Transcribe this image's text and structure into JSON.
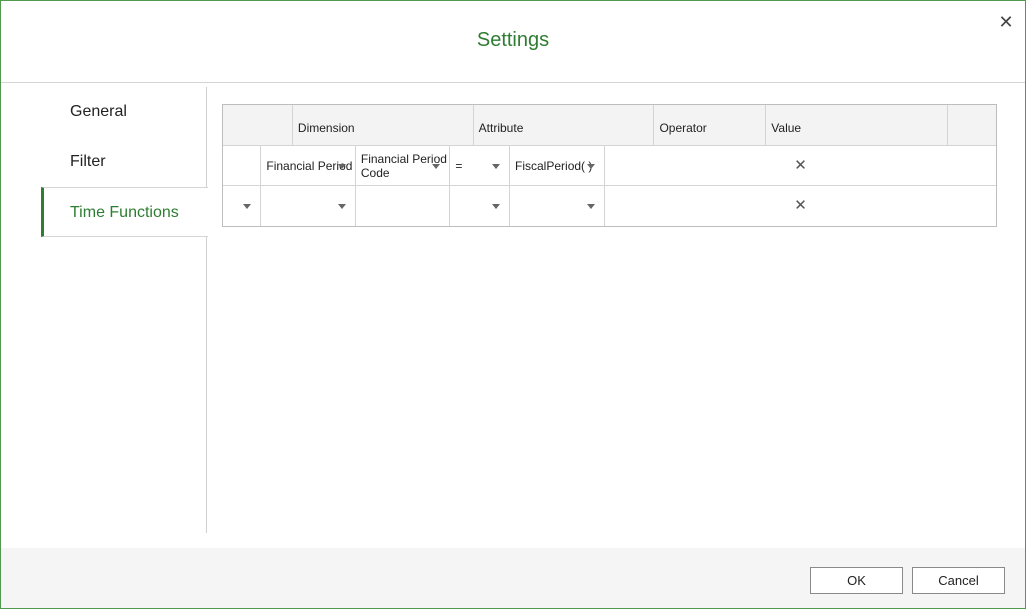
{
  "dialog": {
    "title": "Settings",
    "close_glyph": "✕"
  },
  "sidebar": {
    "items": [
      {
        "label": "General",
        "active": false
      },
      {
        "label": "Filter",
        "active": false
      },
      {
        "label": "Time Functions",
        "active": true
      }
    ]
  },
  "grid": {
    "headers": [
      "",
      "Dimension",
      "Attribute",
      "Operator",
      "Value",
      ""
    ],
    "rows": [
      {
        "prefix": "",
        "dimension": "Financial Period",
        "attribute": "Financial Period Code",
        "operator": "=",
        "value": "FiscalPeriod( )",
        "delete": "✕"
      },
      {
        "prefix": "",
        "dimension": "",
        "attribute": "",
        "operator": "",
        "value": "",
        "delete": "✕"
      }
    ]
  },
  "footer": {
    "ok_label": "OK",
    "cancel_label": "Cancel"
  },
  "colors": {
    "accent": "#2e7d32",
    "border": "#4f9a4f",
    "footer_bg": "#f5f5f5"
  }
}
